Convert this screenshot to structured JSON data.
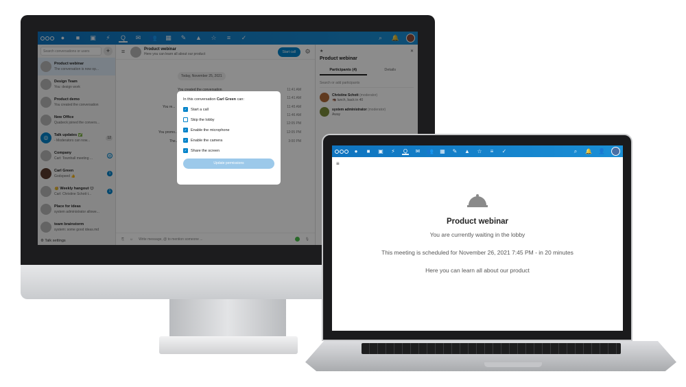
{
  "nav_apps": [
    "●",
    "■",
    "▣",
    "⚡",
    "Q",
    "✉",
    "👥",
    "▦",
    "✎",
    "▲",
    "☆",
    "≡",
    "✓"
  ],
  "desktop": {
    "search_placeholder": "Search conversations or users",
    "add_icon": "+",
    "conversations": [
      {
        "name": "Product webinar",
        "sub": "The conversation is now op...",
        "badge": ""
      },
      {
        "name": "Design Team",
        "sub": "You: design work",
        "badge": ""
      },
      {
        "name": "Product demo",
        "sub": "You created the conversation",
        "badge": ""
      },
      {
        "name": "New Office",
        "sub": "Quabeck joined the convers...",
        "badge": ""
      },
      {
        "name": "Talk updates ✅",
        "sub": "- Moderators can now...",
        "badge": "12"
      },
      {
        "name": "Company",
        "sub": "Carl: Townhall meeting ...",
        "badge": "@"
      },
      {
        "name": "Carl Green",
        "sub": "Godspeed 👍",
        "badge": "1"
      },
      {
        "name": "🥳 Weekly hangout 😊",
        "sub": "Carl: Christine Schott t...",
        "badge": "1"
      },
      {
        "name": "Place for ideas",
        "sub": "system administrator allowe...",
        "badge": ""
      },
      {
        "name": "team brainstorm",
        "sub": "system: some good ideas.md",
        "badge": ""
      }
    ],
    "talk_settings": "Talk settings",
    "chat": {
      "title": "Product webinar",
      "description": "Here you can learn all about our product",
      "start_call": "Start call",
      "date": "Today, November 25, 2021",
      "messages": [
        {
          "text": "You created the conversation",
          "time": "11:41 AM"
        },
        {
          "text": "",
          "time": "11:41 AM"
        },
        {
          "text": "You re...",
          "time": "11:45 AM"
        },
        {
          "text": "",
          "time": "11:46 AM"
        },
        {
          "text": "...",
          "time": "12:05 PM"
        },
        {
          "text": "You promo...",
          "time": "12:05 PM"
        },
        {
          "text": "The...",
          "time": "3:00 PM"
        }
      ],
      "compose_placeholder": "Write message, @ to mention someone ..."
    },
    "right_panel": {
      "title": "Product webinar",
      "tab_participants": "Participants (4)",
      "tab_details": "Details",
      "search_placeholder": "Search or add participants",
      "participants": [
        {
          "name": "Christine Schott",
          "role": "(moderator)",
          "status": "🦔 lunch, back in 40"
        },
        {
          "name": "system administrator",
          "role": "(moderator)",
          "status": "Away"
        }
      ]
    },
    "modal": {
      "title_prefix": "In this conversation",
      "title_name": "Carl Green",
      "title_suffix": "can:",
      "permissions": [
        {
          "label": "Start a call",
          "checked": true
        },
        {
          "label": "Skip the lobby",
          "checked": false
        },
        {
          "label": "Enable the microphone",
          "checked": true
        },
        {
          "label": "Enable the camera",
          "checked": true
        },
        {
          "label": "Share the screen",
          "checked": true
        }
      ],
      "update_button": "Update permissions"
    }
  },
  "laptop": {
    "menu_icon": "≡",
    "lobby": {
      "title": "Product webinar",
      "waiting": "You are currently waiting in the lobby",
      "schedule": "This meeting is scheduled for November 26, 2021 7:45 PM - in 20 minutes",
      "description": "Here you can learn all about our product"
    }
  }
}
